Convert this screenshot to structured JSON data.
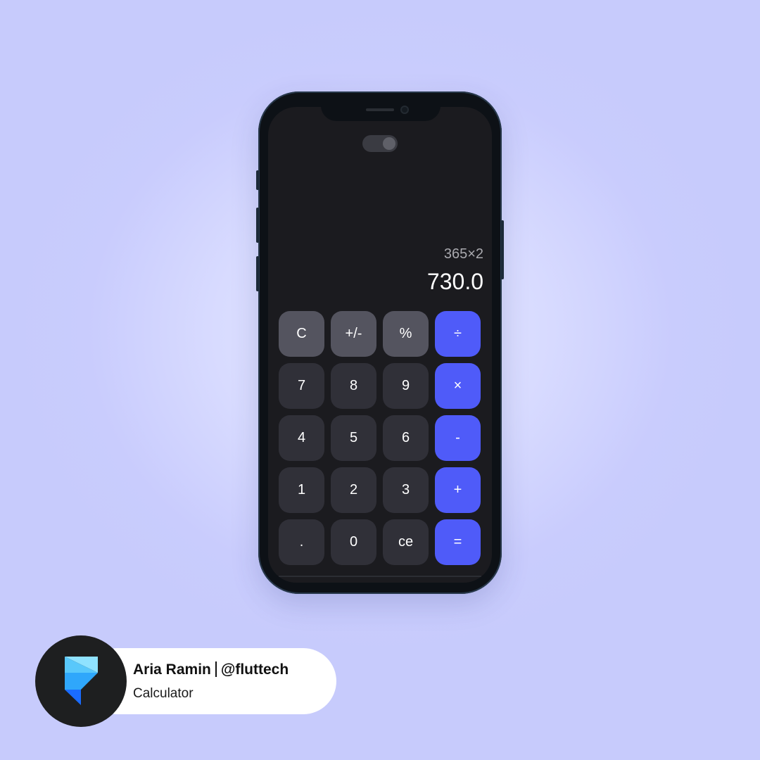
{
  "calculator": {
    "expression": "365×2",
    "result": "730.0",
    "theme_toggle_state": "on",
    "keys": [
      {
        "label": "C",
        "kind": "func",
        "name": "clear-button"
      },
      {
        "label": "+/-",
        "kind": "func",
        "name": "sign-toggle-button"
      },
      {
        "label": "%",
        "kind": "func",
        "name": "percent-button"
      },
      {
        "label": "÷",
        "kind": "op",
        "name": "divide-button"
      },
      {
        "label": "7",
        "kind": "num",
        "name": "digit-7-button"
      },
      {
        "label": "8",
        "kind": "num",
        "name": "digit-8-button"
      },
      {
        "label": "9",
        "kind": "num",
        "name": "digit-9-button"
      },
      {
        "label": "×",
        "kind": "op",
        "name": "multiply-button"
      },
      {
        "label": "4",
        "kind": "num",
        "name": "digit-4-button"
      },
      {
        "label": "5",
        "kind": "num",
        "name": "digit-5-button"
      },
      {
        "label": "6",
        "kind": "num",
        "name": "digit-6-button"
      },
      {
        "label": "-",
        "kind": "op",
        "name": "subtract-button"
      },
      {
        "label": "1",
        "kind": "num",
        "name": "digit-1-button"
      },
      {
        "label": "2",
        "kind": "num",
        "name": "digit-2-button"
      },
      {
        "label": "3",
        "kind": "num",
        "name": "digit-3-button"
      },
      {
        "label": "+",
        "kind": "op",
        "name": "add-button"
      },
      {
        "label": ".",
        "kind": "num",
        "name": "decimal-button"
      },
      {
        "label": "0",
        "kind": "num",
        "name": "digit-0-button"
      },
      {
        "label": "ce",
        "kind": "num",
        "name": "clear-entry-button"
      },
      {
        "label": "=",
        "kind": "op",
        "name": "equals-button"
      }
    ]
  },
  "author": {
    "name": "Aria Ramin",
    "handle": "@fluttech",
    "subtitle": "Calculator",
    "logo_icon": "framer-logo-icon"
  },
  "colors": {
    "background": "#c9ccfd",
    "screen": "#1b1b1f",
    "operator_key": "#4f5bf9",
    "function_key": "#54545f",
    "number_key": "#303038"
  }
}
